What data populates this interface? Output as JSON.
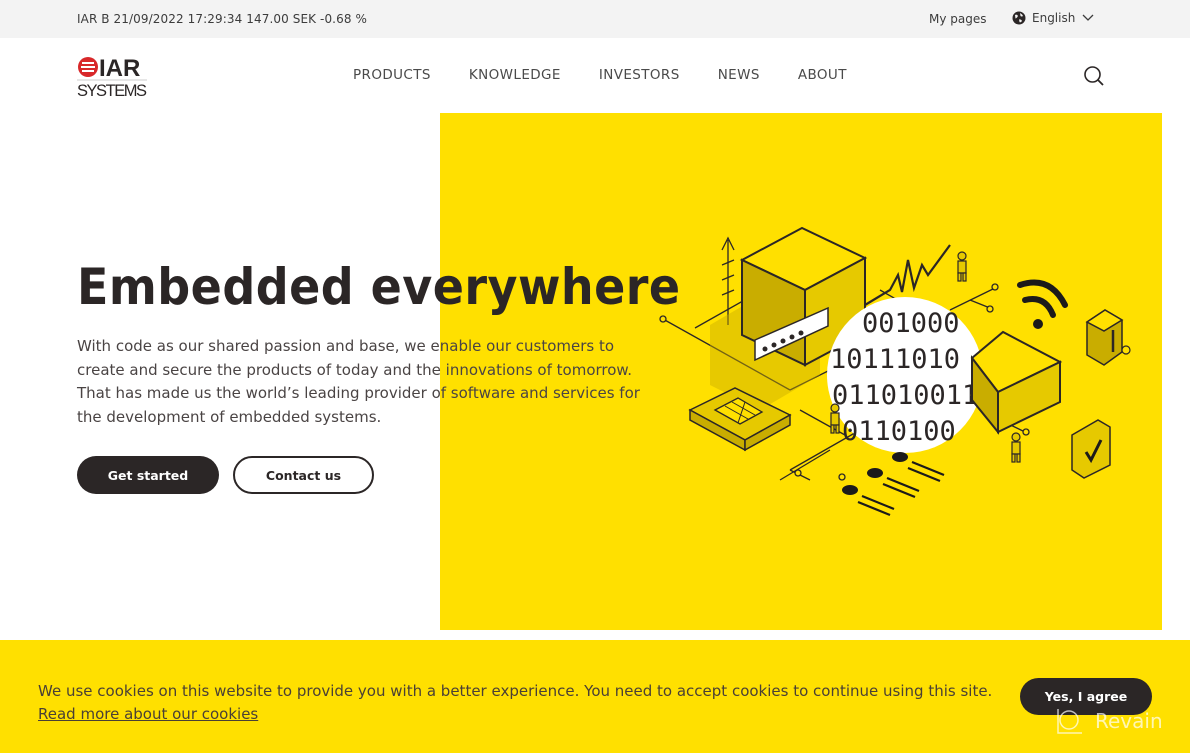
{
  "topbar": {
    "ticker": "IAR B 21/09/2022 17:29:34 147.00 SEK -0.68 %",
    "my_pages": "My pages",
    "language": "English"
  },
  "header": {
    "logo_top": "IAR",
    "logo_bottom": "SYSTEMS",
    "nav": [
      "PRODUCTS",
      "KNOWLEDGE",
      "INVESTORS",
      "NEWS",
      "ABOUT"
    ]
  },
  "hero": {
    "title": "Embedded everywhere",
    "lines": [
      "With code as our shared passion and base, we enable our customers to",
      "create and secure the products of today and the innovations of tomorrow.",
      "That has made us the world’s leading provider of software and services for",
      "the development of embedded systems."
    ],
    "primary_button": "Get started",
    "secondary_button": "Contact us",
    "binary_lines": [
      "001000",
      "10111010",
      "011010011",
      "0110100"
    ],
    "accent_color": "#ffe000"
  },
  "cookie": {
    "message": "We use cookies on this website to provide you with a better experience. You need to accept cookies to continue using this site.",
    "link": "Read more about our cookies",
    "agree_button": "Yes, I agree",
    "background": "#ffe000"
  },
  "watermark": "Revain"
}
